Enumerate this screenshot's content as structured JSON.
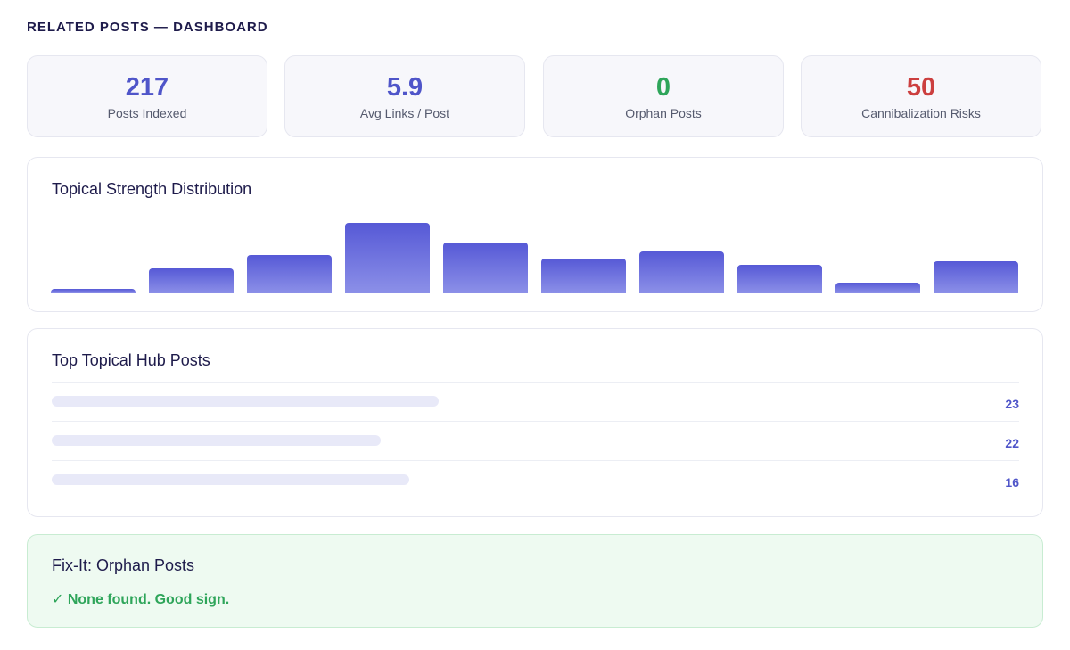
{
  "header": {
    "title": "RELATED POSTS — DASHBOARD"
  },
  "stats": [
    {
      "value": "217",
      "label": "Posts Indexed",
      "color": "#4f55c9"
    },
    {
      "value": "5.9",
      "label": "Avg Links / Post",
      "color": "#4f55c9"
    },
    {
      "value": "0",
      "label": "Orphan Posts",
      "color": "#2ea55a"
    },
    {
      "value": "50",
      "label": "Cannibalization Risks",
      "color": "#cc3f3f"
    }
  ],
  "distribution": {
    "title": "Topical Strength Distribution",
    "chart_data": {
      "type": "bar",
      "values": [
        6,
        36,
        54,
        100,
        72,
        49,
        59,
        40,
        15,
        45
      ]
    }
  },
  "hubs": {
    "title": "Top Topical Hub Posts",
    "rows": [
      {
        "value": "23",
        "fill": 0.4
      },
      {
        "value": "22",
        "fill": 0.34
      },
      {
        "value": "16",
        "fill": 0.37
      }
    ]
  },
  "fix_it": {
    "title": "Fix-It: Orphan Posts",
    "message": "✓ None found. Good sign."
  }
}
